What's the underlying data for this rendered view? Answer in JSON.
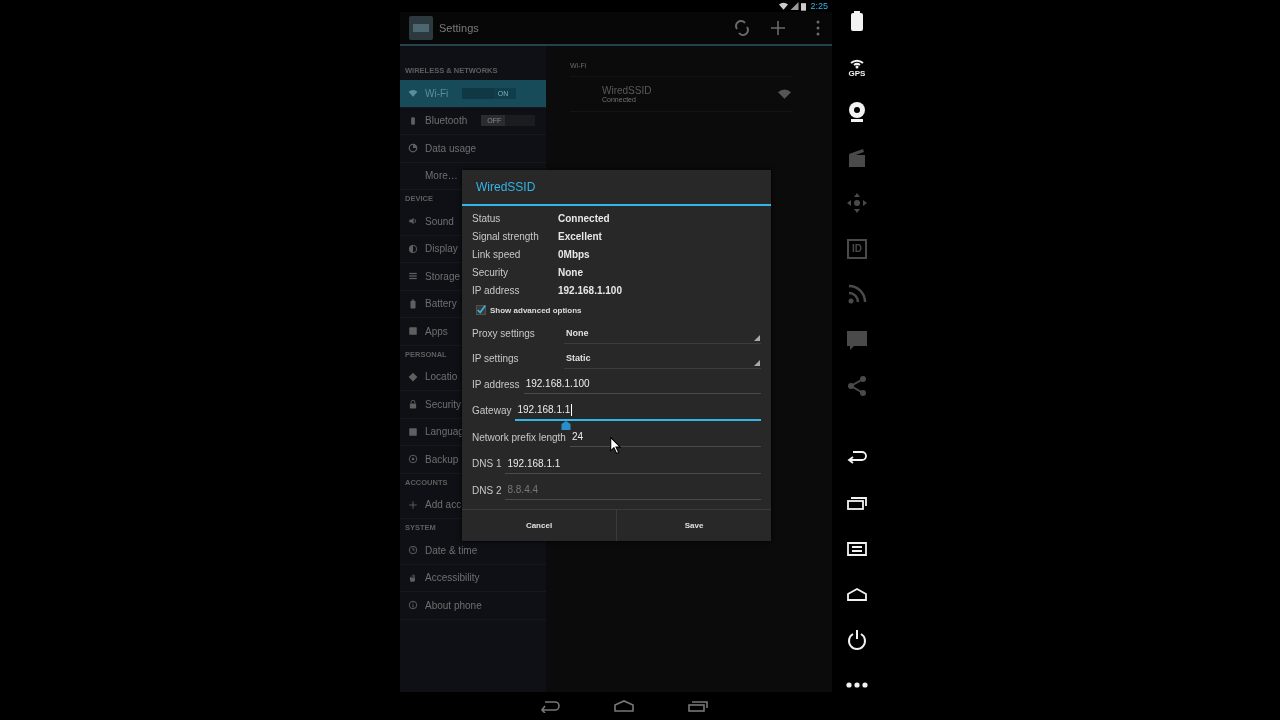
{
  "status_bar": {
    "time": "2:25"
  },
  "action_bar": {
    "title": "Settings"
  },
  "sidebar": {
    "items": [
      {
        "kind": "header",
        "label": "WIRELESS & NETWORKS"
      },
      {
        "kind": "item",
        "label": "Wi-Fi",
        "selected": true,
        "toggle": {
          "label": "ON",
          "on": true
        }
      },
      {
        "kind": "item",
        "label": "Bluetooth",
        "selected": false,
        "toggle": {
          "label": "OFF",
          "on": false
        }
      },
      {
        "kind": "item",
        "label": "Data usage",
        "selected": false
      },
      {
        "kind": "item",
        "label": "More…",
        "selected": false
      },
      {
        "kind": "header",
        "label": "DEVICE"
      },
      {
        "kind": "item",
        "label": "Sound",
        "selected": false
      },
      {
        "kind": "item",
        "label": "Display",
        "selected": false
      },
      {
        "kind": "item",
        "label": "Storage",
        "selected": false
      },
      {
        "kind": "item",
        "label": "Battery",
        "selected": false
      },
      {
        "kind": "item",
        "label": "Apps",
        "selected": false
      },
      {
        "kind": "header",
        "label": "PERSONAL"
      },
      {
        "kind": "item",
        "label": "Locatio",
        "selected": false
      },
      {
        "kind": "item",
        "label": "Security",
        "selected": false
      },
      {
        "kind": "item",
        "label": "Languag",
        "selected": false
      },
      {
        "kind": "item",
        "label": "Backup",
        "selected": false
      },
      {
        "kind": "header",
        "label": "ACCOUNTS"
      },
      {
        "kind": "item",
        "label": "Add acc",
        "selected": false
      },
      {
        "kind": "header",
        "label": "SYSTEM"
      },
      {
        "kind": "item",
        "label": "Date & time",
        "selected": false
      },
      {
        "kind": "item",
        "label": "Accessibility",
        "selected": false
      },
      {
        "kind": "item",
        "label": "About phone",
        "selected": false
      }
    ]
  },
  "content": {
    "header": "Wi-Fi",
    "networks": [
      {
        "name": "WiredSSID",
        "status": "Connected"
      }
    ]
  },
  "dialog": {
    "title": "WiredSSID",
    "info": [
      {
        "label": "Status",
        "value": "Connected"
      },
      {
        "label": "Signal strength",
        "value": "Excellent"
      },
      {
        "label": "Link speed",
        "value": "0Mbps"
      },
      {
        "label": "Security",
        "value": "None"
      },
      {
        "label": "IP address",
        "value": "192.168.1.100"
      }
    ],
    "advanced": {
      "label": "Show advanced options",
      "checked": true
    },
    "spinners": [
      {
        "label": "Proxy settings",
        "value": "None"
      },
      {
        "label": "IP settings",
        "value": "Static"
      }
    ],
    "fields": [
      {
        "label": "IP address",
        "value": "192.168.1.100",
        "focused": false
      },
      {
        "label": "Gateway",
        "value": "192.168.1.1",
        "focused": true
      },
      {
        "label": "Network prefix length",
        "value": "24",
        "focused": false
      },
      {
        "label": "DNS 1",
        "value": "192.168.1.1",
        "focused": false
      },
      {
        "label": "DNS 2",
        "placeholder": "8.8.4.4",
        "focused": false
      }
    ],
    "buttons": [
      "Cancel",
      "Save"
    ]
  },
  "device_tools": [
    {
      "kind": "battery",
      "disabled": false
    },
    {
      "kind": "gps",
      "label": "GPS",
      "disabled": false
    },
    {
      "kind": "webcam",
      "disabled": false
    },
    {
      "kind": "clapper",
      "disabled": true
    },
    {
      "kind": "dpad",
      "disabled": true
    },
    {
      "kind": "id",
      "label": "ID",
      "disabled": true
    },
    {
      "kind": "rss",
      "disabled": true
    },
    {
      "kind": "sms",
      "disabled": true
    },
    {
      "kind": "share",
      "disabled": true
    }
  ],
  "nav_tools": [
    {
      "kind": "back",
      "disabled": false
    },
    {
      "kind": "recent",
      "disabled": false
    },
    {
      "kind": "menu",
      "disabled": false
    },
    {
      "kind": "home",
      "disabled": false
    },
    {
      "kind": "power",
      "disabled": false
    },
    {
      "kind": "more",
      "disabled": false
    }
  ]
}
